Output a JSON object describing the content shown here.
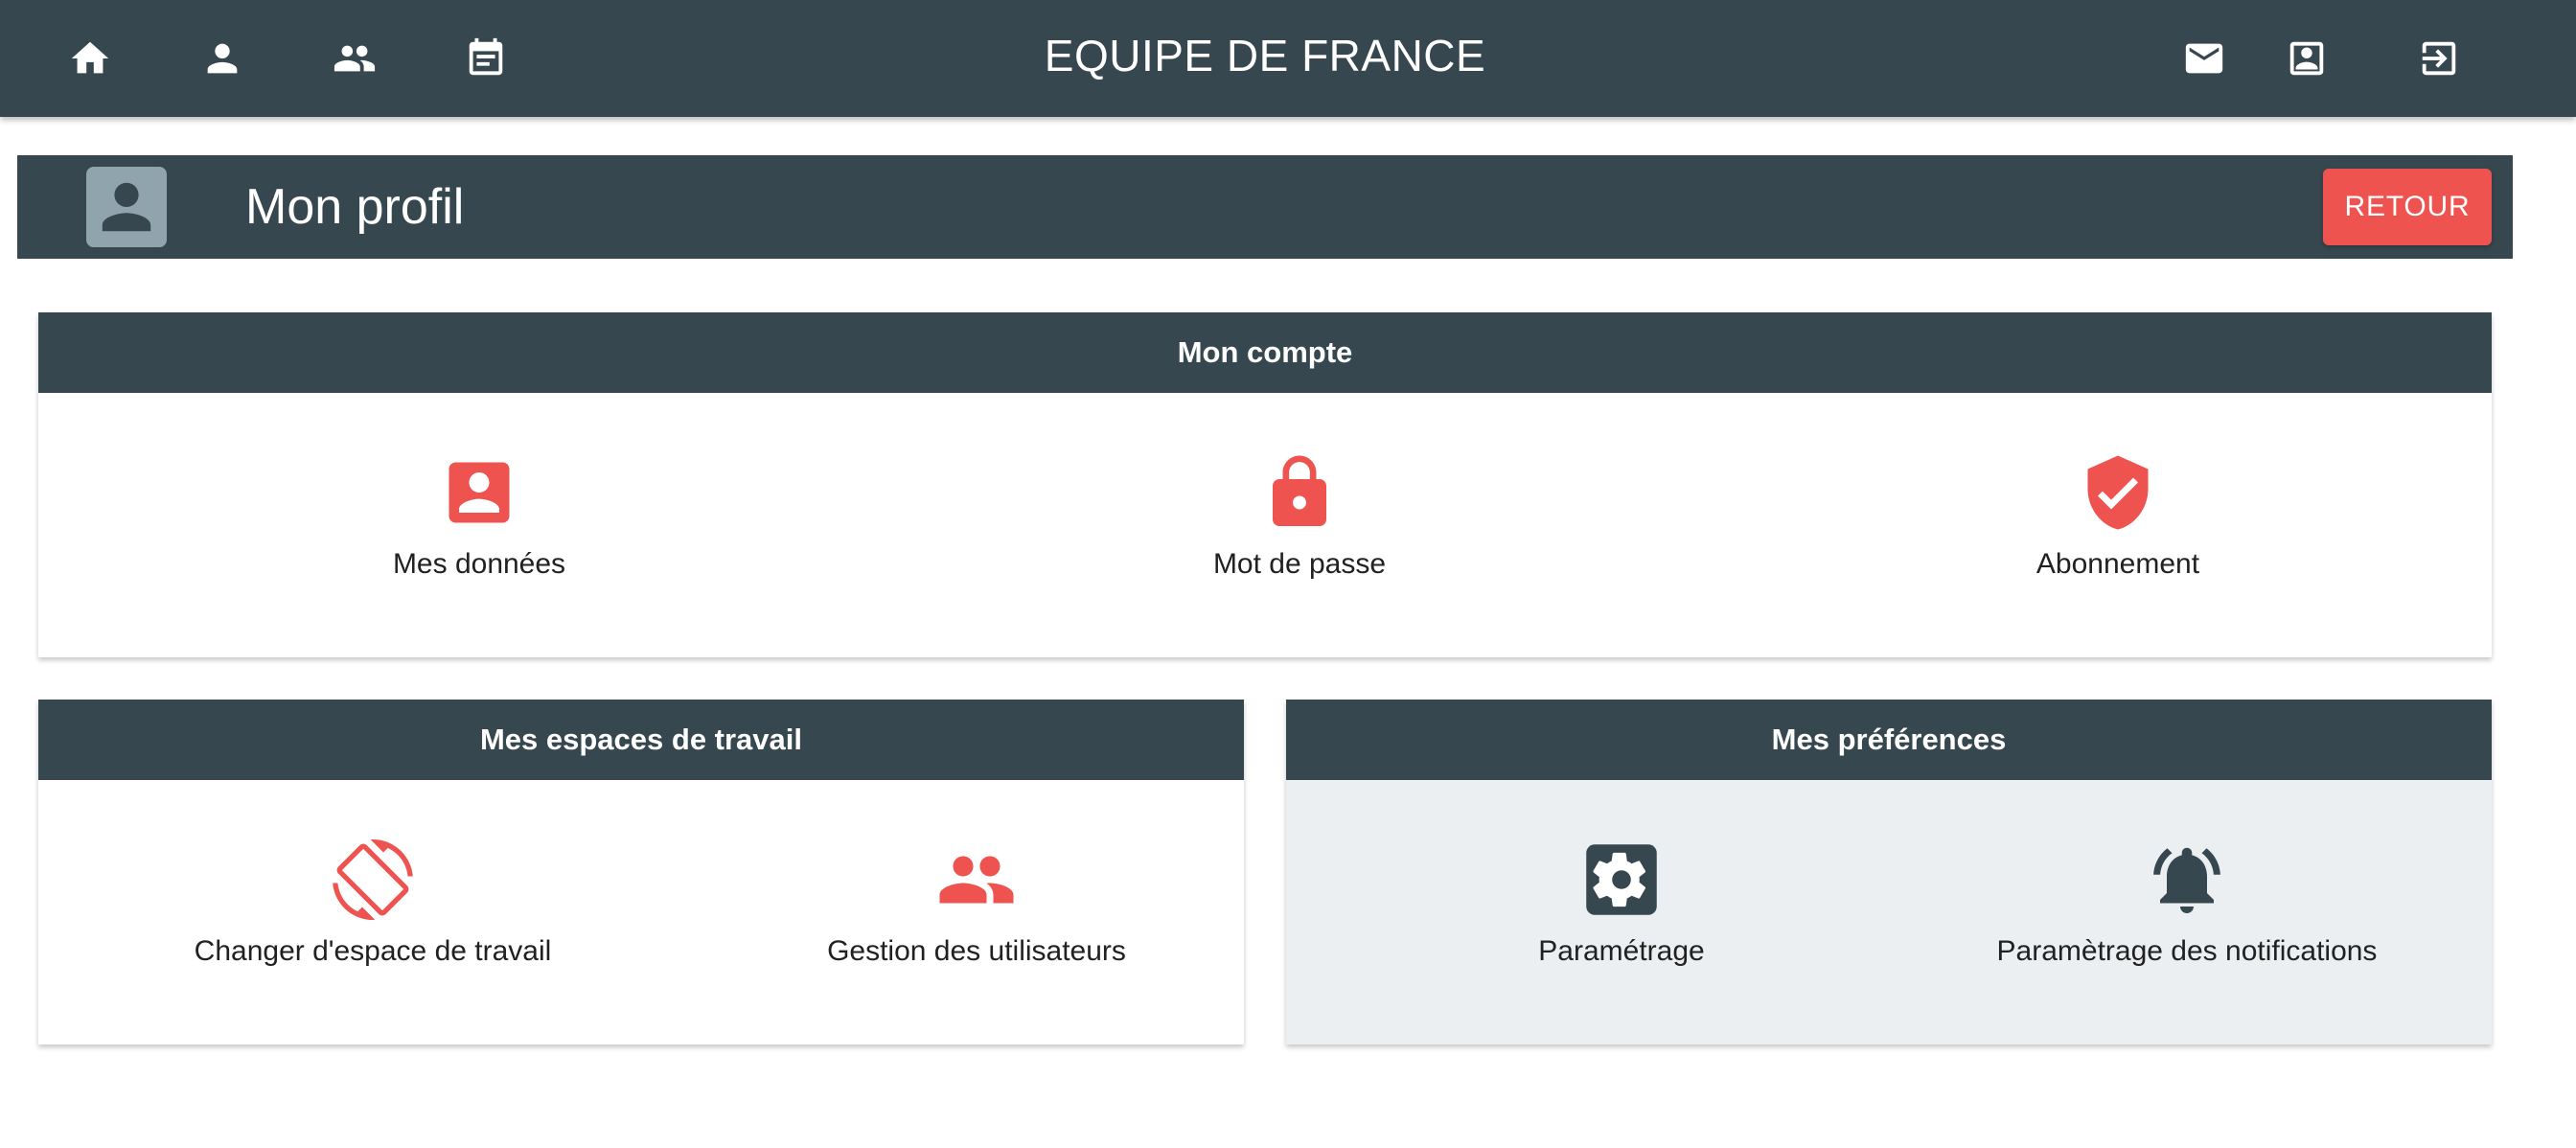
{
  "app": {
    "title": "EQUIPE DE FRANCE"
  },
  "topbar": {
    "left_icons": [
      "home-icon",
      "person-icon",
      "people-icon",
      "calendar-icon"
    ],
    "right_icons": [
      "mail-icon",
      "contact-icon",
      "logout-icon"
    ]
  },
  "page": {
    "title": "Mon profil",
    "back_label": "RETOUR"
  },
  "colors": {
    "primary": "#37474f",
    "accent": "#ef5350",
    "muted_bg": "#eceff1",
    "avatar_bg": "#90a4ae"
  },
  "account": {
    "header": "Mon compte",
    "items": [
      {
        "label": "Mes données",
        "icon": "account-box-icon"
      },
      {
        "label": "Mot de passe",
        "icon": "lock-icon"
      },
      {
        "label": "Abonnement",
        "icon": "verified-shield-icon"
      }
    ]
  },
  "workspaces": {
    "header": "Mes espaces de travail",
    "items": [
      {
        "label": "Changer d'espace de travail",
        "icon": "rotate-icon"
      },
      {
        "label": "Gestion des utilisateurs",
        "icon": "people-icon"
      }
    ]
  },
  "preferences": {
    "header": "Mes préférences",
    "items": [
      {
        "label": "Paramétrage",
        "icon": "settings-icon"
      },
      {
        "label": "Paramètrage des notifications",
        "icon": "bell-ringing-icon"
      }
    ]
  }
}
